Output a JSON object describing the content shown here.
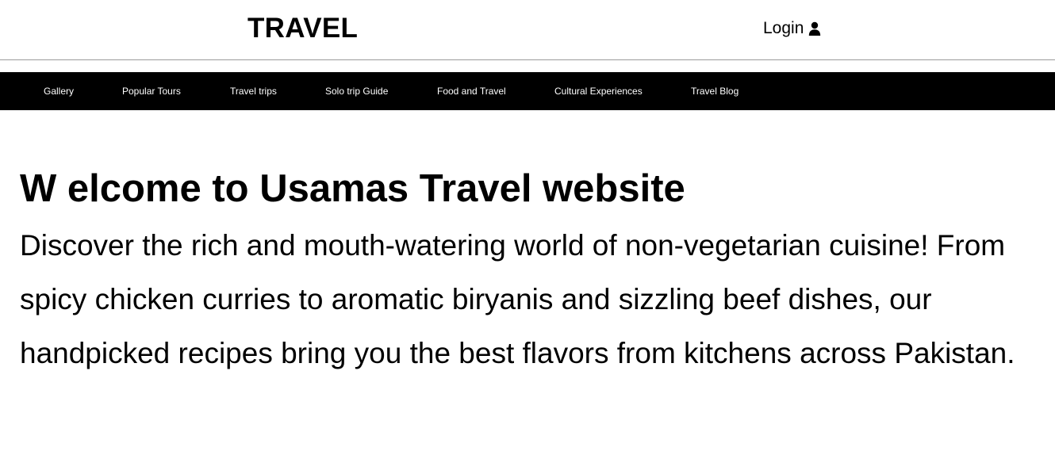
{
  "header": {
    "brand": "TRAVEL",
    "login_label": "Login",
    "login_icon": "user-icon"
  },
  "nav": {
    "items": [
      {
        "label": "Gallery"
      },
      {
        "label": "Popular Tours"
      },
      {
        "label": "Travel trips"
      },
      {
        "label": "Solo trip Guide"
      },
      {
        "label": "Food and Travel"
      },
      {
        "label": "Cultural Experiences"
      },
      {
        "label": "Travel Blog"
      }
    ]
  },
  "main": {
    "heading": "W elcome to Usamas Travel website",
    "paragraph": "Discover the rich and mouth-watering world of non-vegetarian cuisine! From spicy chicken curries to aromatic biryanis and sizzling beef dishes, our handpicked recipes bring you the best flavors from kitchens across Pakistan."
  },
  "colors": {
    "nav_background": "#000000",
    "nav_text": "#ffffff",
    "page_background": "#ffffff",
    "header_divider": "#9a9a9a"
  }
}
